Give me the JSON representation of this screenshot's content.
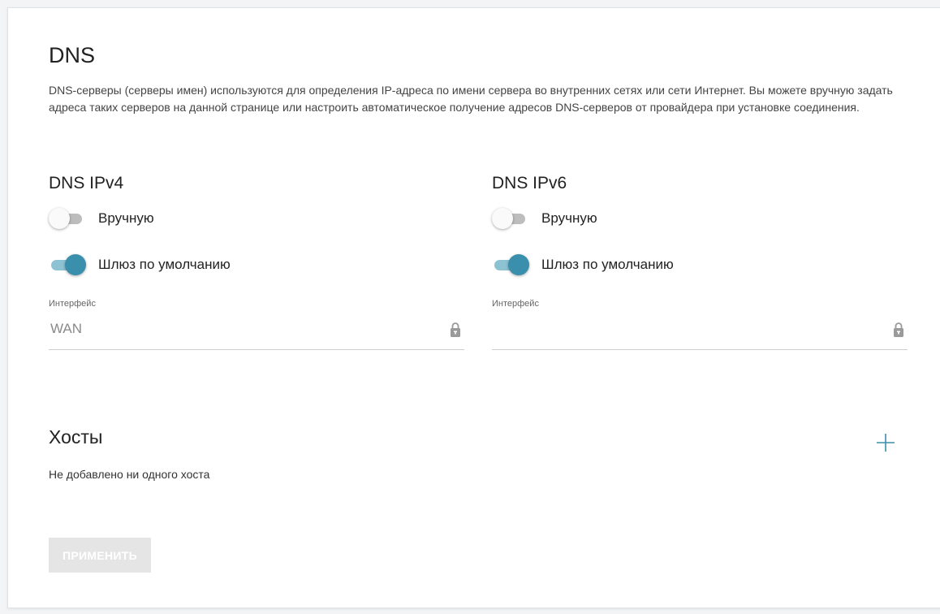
{
  "page": {
    "title": "DNS",
    "description": "DNS-серверы (серверы имен) используются для определения IP-адреса по имени сервера во внутренних сетях или сети Интернет. Вы можете вручную задать адреса таких серверов на данной странице или настроить автоматическое получение адресов DNS-серверов от провайдера при установке соединения."
  },
  "ipv4": {
    "title": "DNS IPv4",
    "manual_label": "Вручную",
    "manual_on": false,
    "gateway_label": "Шлюз по умолчанию",
    "gateway_on": true,
    "interface_label": "Интерфейс",
    "interface_value": "WAN"
  },
  "ipv6": {
    "title": "DNS IPv6",
    "manual_label": "Вручную",
    "manual_on": false,
    "gateway_label": "Шлюз по умолчанию",
    "gateway_on": true,
    "interface_label": "Интерфейс",
    "interface_value": ""
  },
  "hosts": {
    "title": "Хосты",
    "empty_text": "Не добавлено ни одного хоста",
    "add_icon": "plus-icon"
  },
  "actions": {
    "apply_label": "ПРИМЕНИТЬ",
    "apply_enabled": false
  },
  "colors": {
    "accent": "#3a90ac",
    "accent_track": "#8dc2d3",
    "toggle_off_track": "#bdbdbd",
    "disabled_button_bg": "#e5e5e5",
    "lock_icon": "#9a9a9a"
  }
}
